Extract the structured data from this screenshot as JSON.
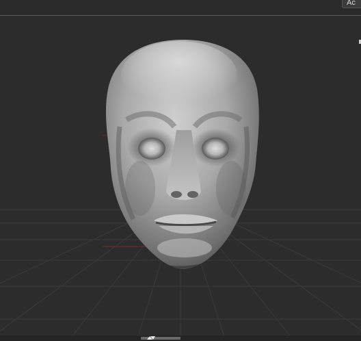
{
  "toolbar": {
    "corner_button_label": "Ac"
  },
  "viewport": {
    "grid": true,
    "subject": "sculpted-head-mesh",
    "colors": {
      "background": "#2c2c2c",
      "grid_line": "#3a3a3a",
      "axis_line": "#8a2a2a",
      "mesh_base": "#9a9a9a"
    }
  },
  "icons": {
    "bottom_handle": "collapse-toggle-icon"
  }
}
